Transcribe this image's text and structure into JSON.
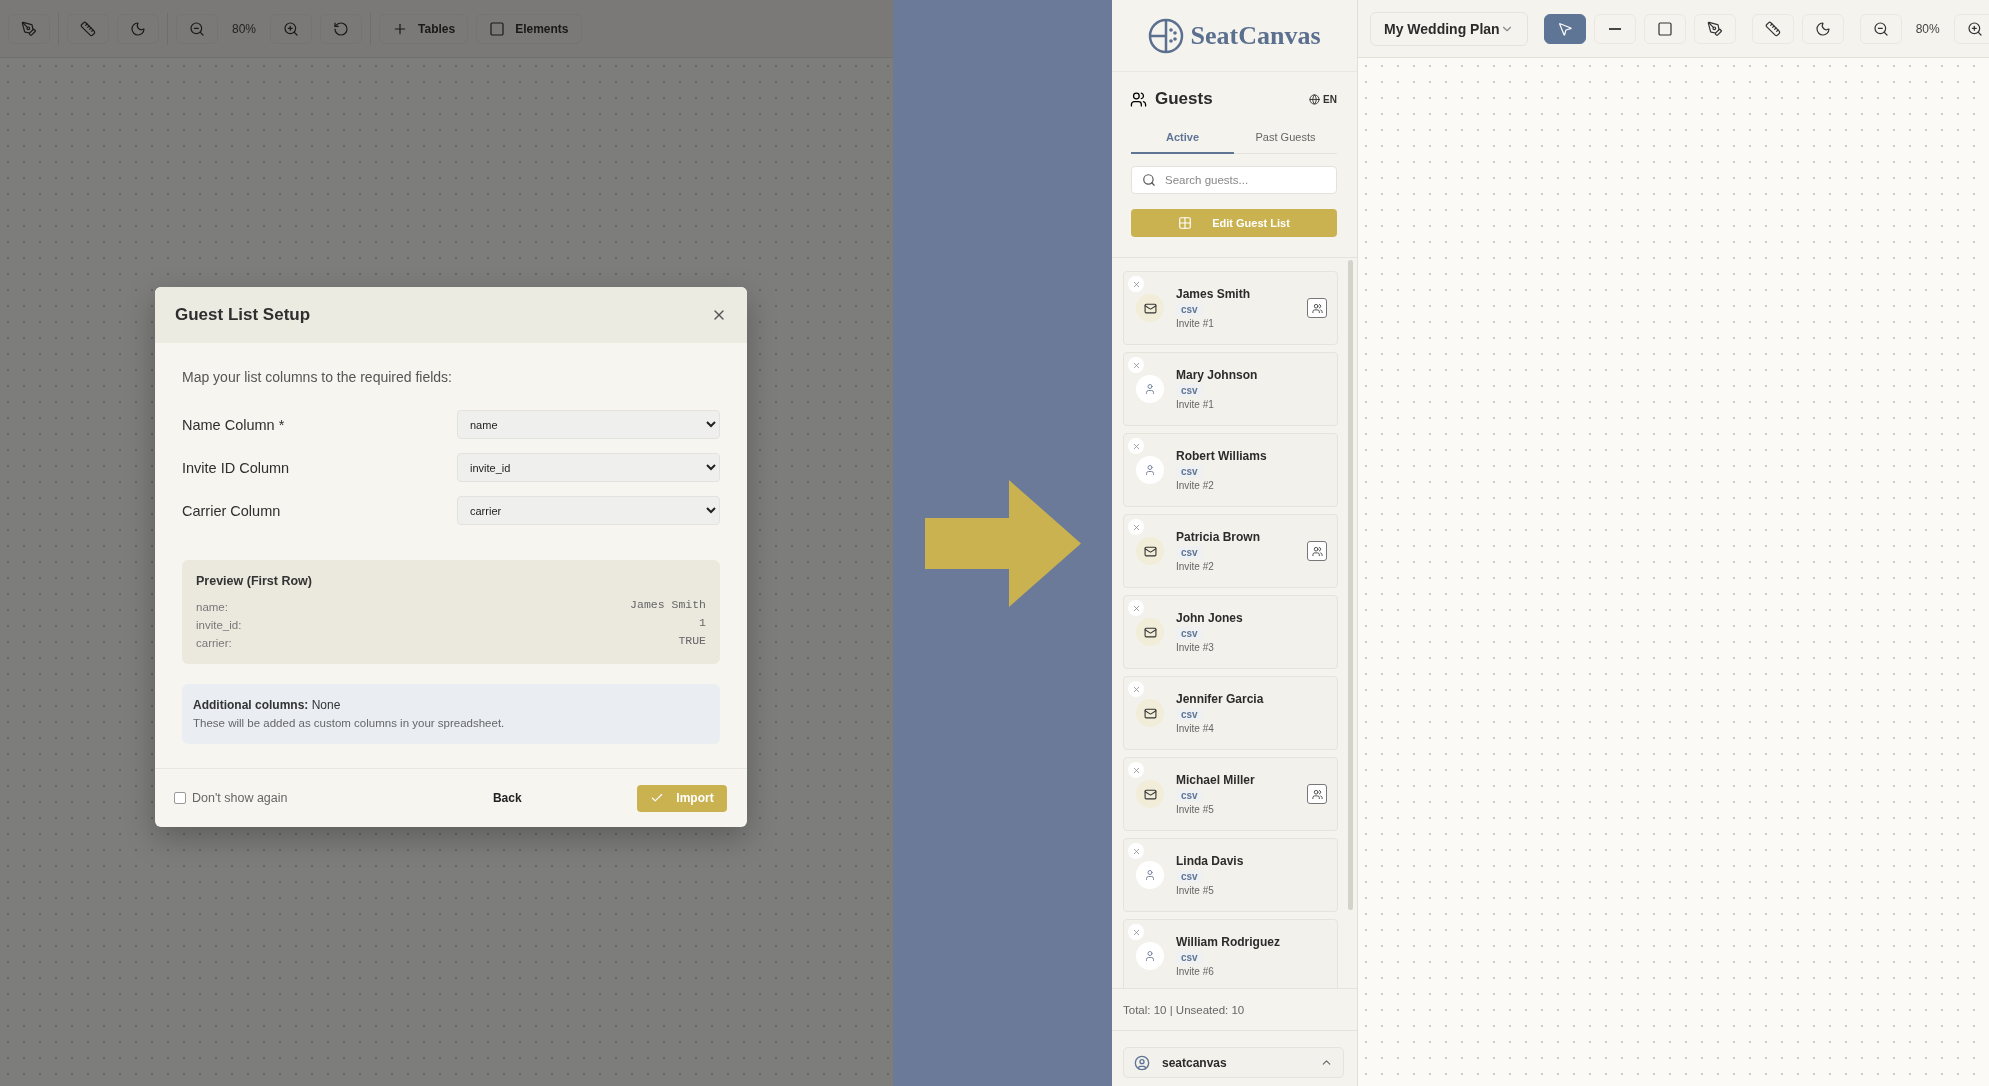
{
  "left_app": {
    "toolbar": [
      {
        "kind": "pen"
      },
      {
        "kind": "ruler"
      },
      {
        "kind": "moon"
      },
      {
        "kind": "zoom-out"
      },
      {
        "kind": "zoom-label",
        "label": "80%"
      },
      {
        "kind": "zoom-in"
      },
      {
        "kind": "reset"
      },
      {
        "kind": "tables",
        "label": "Tables"
      },
      {
        "kind": "elements",
        "label": "Elements"
      }
    ],
    "dialog": {
      "title": "Guest List Setup",
      "intro": "Map your list columns to the required fields:",
      "fields": [
        {
          "label": "Name Column *",
          "value": "name"
        },
        {
          "label": "Invite ID Column",
          "value": "invite_id"
        },
        {
          "label": "Carrier Column",
          "value": "carrier"
        }
      ],
      "preview": {
        "title": "Preview (First Row)",
        "rows": [
          {
            "key": "name:",
            "value": "James Smith"
          },
          {
            "key": "invite_id:",
            "value": "1"
          },
          {
            "key": "carrier:",
            "value": "TRUE"
          }
        ]
      },
      "additional": {
        "summary": "**Additional columns:** None",
        "note": "These will be added as custom columns in your spreadsheet."
      },
      "dont_show_again": {
        "label": "Don't show again",
        "checked": false
      },
      "back": "Back",
      "import": "Import"
    }
  },
  "right_app": {
    "logo": "SeatCanvas",
    "sidebar": {
      "title": "Guests",
      "language": "EN",
      "tabs": [
        {
          "label": "Active",
          "selected": true
        },
        {
          "label": "Past Guests",
          "selected": false
        }
      ],
      "search": {
        "placeholder": "Search guests..."
      },
      "edit_button": "Edit Guest List",
      "guests": [
        {
          "name": "James Smith",
          "tag": "csv",
          "invite": "Invite #1",
          "kind": "email",
          "group_button": true
        },
        {
          "name": "Mary Johnson",
          "tag": "csv",
          "invite": "Invite #1",
          "kind": "person",
          "group_button": false
        },
        {
          "name": "Robert Williams",
          "tag": "csv",
          "invite": "Invite #2",
          "kind": "person",
          "group_button": false
        },
        {
          "name": "Patricia Brown",
          "tag": "csv",
          "invite": "Invite #2",
          "kind": "email",
          "group_button": true
        },
        {
          "name": "John Jones",
          "tag": "csv",
          "invite": "Invite #3",
          "kind": "email",
          "group_button": false
        },
        {
          "name": "Jennifer Garcia",
          "tag": "csv",
          "invite": "Invite #4",
          "kind": "email",
          "group_button": false
        },
        {
          "name": "Michael Miller",
          "tag": "csv",
          "invite": "Invite #5",
          "kind": "email",
          "group_button": true
        },
        {
          "name": "Linda Davis",
          "tag": "csv",
          "invite": "Invite #5",
          "kind": "person",
          "group_button": false
        },
        {
          "name": "William Rodriguez",
          "tag": "csv",
          "invite": "Invite #6",
          "kind": "person",
          "group_button": false
        }
      ],
      "totals": "Total: 10 | Unseated: 10",
      "account": "seatcanvas"
    },
    "toolbar": {
      "plan": "My Wedding Plan",
      "tools": [
        {
          "kind": "select",
          "selected": true
        },
        {
          "kind": "line",
          "selected": false
        },
        {
          "kind": "rectangle",
          "selected": false
        },
        {
          "kind": "pen",
          "selected": false
        },
        {
          "kind": "ruler",
          "selected": false
        },
        {
          "kind": "moon",
          "selected": false
        },
        {
          "kind": "zoom-out",
          "selected": false
        },
        {
          "kind": "zoom-label",
          "label": "80%"
        },
        {
          "kind": "zoom-in",
          "selected": false
        }
      ]
    }
  }
}
